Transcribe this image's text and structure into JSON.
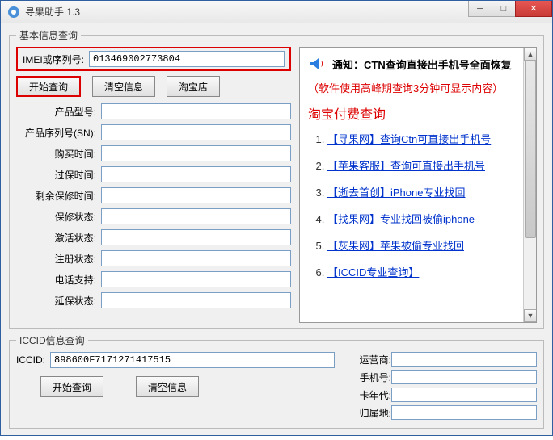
{
  "window": {
    "title": "寻果助手 1.3"
  },
  "basic": {
    "legend": "基本信息查询",
    "imei_label": "IMEI或序列号:",
    "imei_value": "013469002773804",
    "buttons": {
      "search": "开始查询",
      "clear": "清空信息",
      "taobao": "淘宝店"
    },
    "fields": [
      {
        "label": "产品型号:"
      },
      {
        "label": "产品序列号(SN):"
      },
      {
        "label": "购买时间:"
      },
      {
        "label": "过保时间:"
      },
      {
        "label": "剩余保修时间:"
      },
      {
        "label": "保修状态:"
      },
      {
        "label": "激活状态:"
      },
      {
        "label": "注册状态:"
      },
      {
        "label": "电话支持:"
      },
      {
        "label": "延保状态:"
      }
    ]
  },
  "info": {
    "notice_prefix": "通知：",
    "notice_text": "CTN查询直接出手机号全面恢复",
    "red_line": "（软件使用高峰期查询3分钟可显示内容）",
    "section_title": "淘宝付费查询",
    "links": [
      "【寻果网】查询Ctn可直接出手机号",
      "【苹果客服】查询可直接出手机号",
      "【逝去首创】iPhone专业找回",
      "【找果网】专业找回被偷iphone",
      "【灰果网】苹果被偷专业找回",
      "【ICCID专业查询】"
    ]
  },
  "iccid": {
    "legend": "ICCID信息查询",
    "label": "ICCID:",
    "value": "898600F7171271417515",
    "buttons": {
      "search": "开始查询",
      "clear": "清空信息"
    },
    "fields": [
      {
        "label": "运营商:"
      },
      {
        "label": "手机号:"
      },
      {
        "label": "卡年代:"
      },
      {
        "label": "归属地:"
      }
    ]
  }
}
